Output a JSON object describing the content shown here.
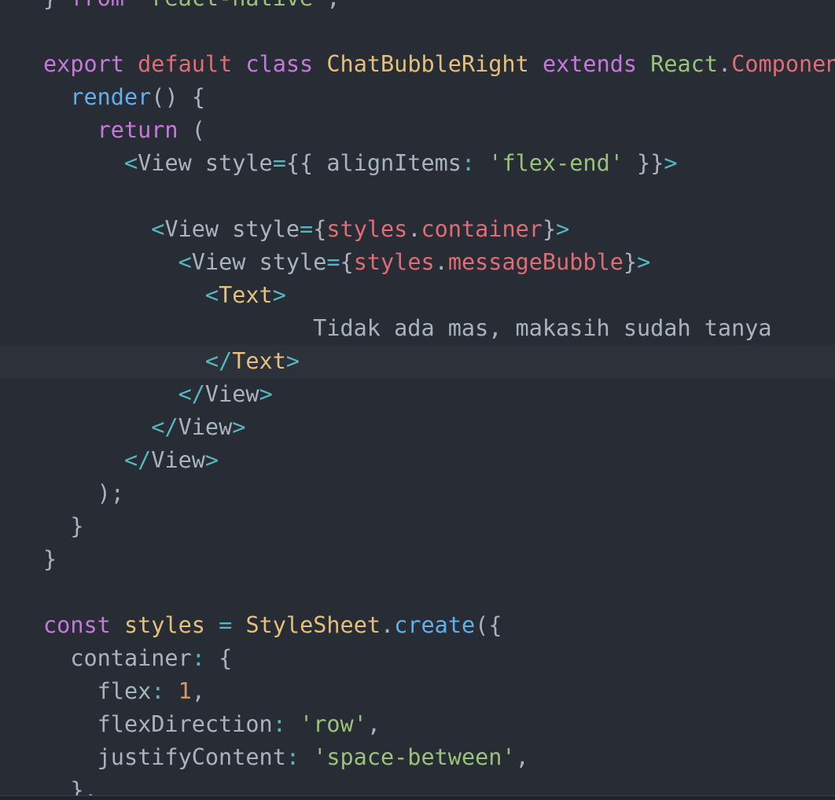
{
  "editor": {
    "theme_colors": {
      "background": "#282c34",
      "current_line": "#2c313a",
      "plain": "#abb2bf",
      "keyword": "#c678dd",
      "class_name": "#e5c07b",
      "string": "#98c379",
      "tag": "#56b6c2",
      "property": "#e06c75",
      "function": "#61afef",
      "number": "#d19a66"
    },
    "cursor_line_index": 11,
    "lines": [
      [
        {
          "t": "} ",
          "c": "plain"
        },
        {
          "t": "from",
          "c": "keyword"
        },
        {
          "t": " ",
          "c": "plain"
        },
        {
          "t": "'react-native'",
          "c": "string"
        },
        {
          "t": ";",
          "c": "plain"
        }
      ],
      [],
      [
        {
          "t": "export",
          "c": "keyword"
        },
        {
          "t": " ",
          "c": "plain"
        },
        {
          "t": "default",
          "c": "property"
        },
        {
          "t": " ",
          "c": "plain"
        },
        {
          "t": "class",
          "c": "keyword"
        },
        {
          "t": " ",
          "c": "plain"
        },
        {
          "t": "ChatBubbleRight",
          "c": "class_name"
        },
        {
          "t": " ",
          "c": "plain"
        },
        {
          "t": "extends",
          "c": "keyword"
        },
        {
          "t": " ",
          "c": "plain"
        },
        {
          "t": "React",
          "c": "string"
        },
        {
          "t": ".",
          "c": "plain"
        },
        {
          "t": "Component",
          "c": "property"
        },
        {
          "t": " {",
          "c": "plain"
        }
      ],
      [
        {
          "t": "  ",
          "c": "plain"
        },
        {
          "t": "render",
          "c": "function"
        },
        {
          "t": "() {",
          "c": "plain"
        }
      ],
      [
        {
          "t": "    ",
          "c": "plain"
        },
        {
          "t": "return",
          "c": "keyword"
        },
        {
          "t": " (",
          "c": "plain"
        }
      ],
      [
        {
          "t": "      ",
          "c": "plain"
        },
        {
          "t": "<",
          "c": "tag"
        },
        {
          "t": "View",
          "c": "plain"
        },
        {
          "t": " style",
          "c": "plain"
        },
        {
          "t": "=",
          "c": "tag"
        },
        {
          "t": "{{ alignItems",
          "c": "plain"
        },
        {
          "t": ":",
          "c": "tag"
        },
        {
          "t": " ",
          "c": "plain"
        },
        {
          "t": "'flex-end'",
          "c": "string"
        },
        {
          "t": " }}",
          "c": "plain"
        },
        {
          "t": ">",
          "c": "tag"
        }
      ],
      [],
      [
        {
          "t": "        ",
          "c": "plain"
        },
        {
          "t": "<",
          "c": "tag"
        },
        {
          "t": "View",
          "c": "plain"
        },
        {
          "t": " style",
          "c": "plain"
        },
        {
          "t": "=",
          "c": "tag"
        },
        {
          "t": "{",
          "c": "plain"
        },
        {
          "t": "styles",
          "c": "property"
        },
        {
          "t": ".",
          "c": "plain"
        },
        {
          "t": "container",
          "c": "property"
        },
        {
          "t": "}",
          "c": "plain"
        },
        {
          "t": ">",
          "c": "tag"
        }
      ],
      [
        {
          "t": "          ",
          "c": "plain"
        },
        {
          "t": "<",
          "c": "tag"
        },
        {
          "t": "View",
          "c": "plain"
        },
        {
          "t": " style",
          "c": "plain"
        },
        {
          "t": "=",
          "c": "tag"
        },
        {
          "t": "{",
          "c": "plain"
        },
        {
          "t": "styles",
          "c": "property"
        },
        {
          "t": ".",
          "c": "plain"
        },
        {
          "t": "messageBubble",
          "c": "property"
        },
        {
          "t": "}",
          "c": "plain"
        },
        {
          "t": ">",
          "c": "tag"
        }
      ],
      [
        {
          "t": "            ",
          "c": "plain"
        },
        {
          "t": "<",
          "c": "tag"
        },
        {
          "t": "Text",
          "c": "class_name"
        },
        {
          "t": ">",
          "c": "tag"
        }
      ],
      [
        {
          "t": "                    ",
          "c": "plain"
        },
        {
          "t": "Tidak ada mas, makasih sudah tanya",
          "c": "plain"
        }
      ],
      [
        {
          "t": "            ",
          "c": "plain"
        },
        {
          "t": "</",
          "c": "tag"
        },
        {
          "t": "Text",
          "c": "class_name"
        },
        {
          "t": ">",
          "c": "tag"
        }
      ],
      [
        {
          "t": "          ",
          "c": "plain"
        },
        {
          "t": "</",
          "c": "tag"
        },
        {
          "t": "View",
          "c": "plain"
        },
        {
          "t": ">",
          "c": "tag"
        }
      ],
      [
        {
          "t": "        ",
          "c": "plain"
        },
        {
          "t": "</",
          "c": "tag"
        },
        {
          "t": "View",
          "c": "plain"
        },
        {
          "t": ">",
          "c": "tag"
        }
      ],
      [
        {
          "t": "      ",
          "c": "plain"
        },
        {
          "t": "</",
          "c": "tag"
        },
        {
          "t": "View",
          "c": "plain"
        },
        {
          "t": ">",
          "c": "tag"
        }
      ],
      [
        {
          "t": "    );",
          "c": "plain"
        }
      ],
      [
        {
          "t": "  }",
          "c": "plain"
        }
      ],
      [
        {
          "t": "}",
          "c": "plain"
        }
      ],
      [],
      [
        {
          "t": "const",
          "c": "keyword"
        },
        {
          "t": " ",
          "c": "plain"
        },
        {
          "t": "styles",
          "c": "class_name"
        },
        {
          "t": " ",
          "c": "plain"
        },
        {
          "t": "=",
          "c": "tag"
        },
        {
          "t": " ",
          "c": "plain"
        },
        {
          "t": "StyleSheet",
          "c": "class_name"
        },
        {
          "t": ".",
          "c": "plain"
        },
        {
          "t": "create",
          "c": "function"
        },
        {
          "t": "({",
          "c": "plain"
        }
      ],
      [
        {
          "t": "  container",
          "c": "plain"
        },
        {
          "t": ":",
          "c": "tag"
        },
        {
          "t": " {",
          "c": "plain"
        }
      ],
      [
        {
          "t": "    flex",
          "c": "plain"
        },
        {
          "t": ":",
          "c": "tag"
        },
        {
          "t": " ",
          "c": "plain"
        },
        {
          "t": "1",
          "c": "number"
        },
        {
          "t": ",",
          "c": "plain"
        }
      ],
      [
        {
          "t": "    flexDirection",
          "c": "plain"
        },
        {
          "t": ":",
          "c": "tag"
        },
        {
          "t": " ",
          "c": "plain"
        },
        {
          "t": "'row'",
          "c": "string"
        },
        {
          "t": ",",
          "c": "plain"
        }
      ],
      [
        {
          "t": "    justifyContent",
          "c": "plain"
        },
        {
          "t": ":",
          "c": "tag"
        },
        {
          "t": " ",
          "c": "plain"
        },
        {
          "t": "'space-between'",
          "c": "string"
        },
        {
          "t": ",",
          "c": "plain"
        }
      ],
      [
        {
          "t": "  },",
          "c": "plain"
        }
      ]
    ]
  }
}
